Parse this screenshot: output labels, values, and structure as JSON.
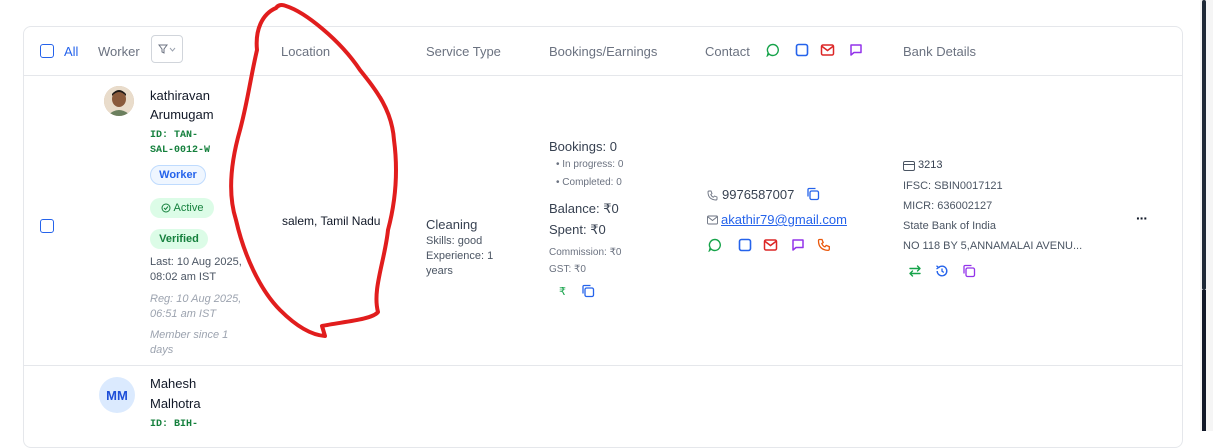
{
  "header": {
    "select_all_label": "All",
    "worker": "Worker",
    "location": "Location",
    "service_type": "Service Type",
    "bookings_earnings": "Bookings/Earnings",
    "contact": "Contact",
    "bank_details": "Bank Details"
  },
  "rows": [
    {
      "name_line1": "kathiravan",
      "name_line2": "Arumugam",
      "id_line1": "ID: TAN-",
      "id_line2": "SAL-0012-W",
      "role_badge": "Worker",
      "status_badge": "Active",
      "verified_badge": "Verified",
      "last_line1": "Last: 10 Aug 2025,",
      "last_line2": "08:02 am IST",
      "reg_line1": "Reg: 10 Aug 2025,",
      "reg_line2": "06:51 am IST",
      "member_line1": "Member since 1",
      "member_line2": "days",
      "location": "salem, Tamil Nadu",
      "service": "Cleaning",
      "skills": "Skills: good",
      "experience_line1": "Experience: 1",
      "experience_line2": "years",
      "bookings": "Bookings: 0",
      "in_progress": "• In progress: 0",
      "completed": "• Completed: 0",
      "balance": "Balance: ₹0",
      "spent": "Spent: ₹0",
      "commission": "Commission: ₹0",
      "gst": "GST: ₹0",
      "rupee_symbol": "₹",
      "phone": "9976587007",
      "email": "akathir79@gmail.com",
      "account": "3213",
      "ifsc": "IFSC: SBIN0017121",
      "micr": "MICR: 636002127",
      "bank_name": "State Bank of India",
      "bank_address": "NO 118 BY 5,ANNAMALAI AVENU...",
      "more": "···"
    },
    {
      "avatar_initials": "MM",
      "name_line1": "Mahesh",
      "name_line2": "Malhotra",
      "id_line1": "ID: BIH-"
    }
  ],
  "colors": {
    "primary": "#2563eb",
    "whatsapp": "#16a34a",
    "email": "#dc2626",
    "sms": "#9333ea",
    "call": "#ea580c",
    "annotation": "#e11d1d"
  }
}
